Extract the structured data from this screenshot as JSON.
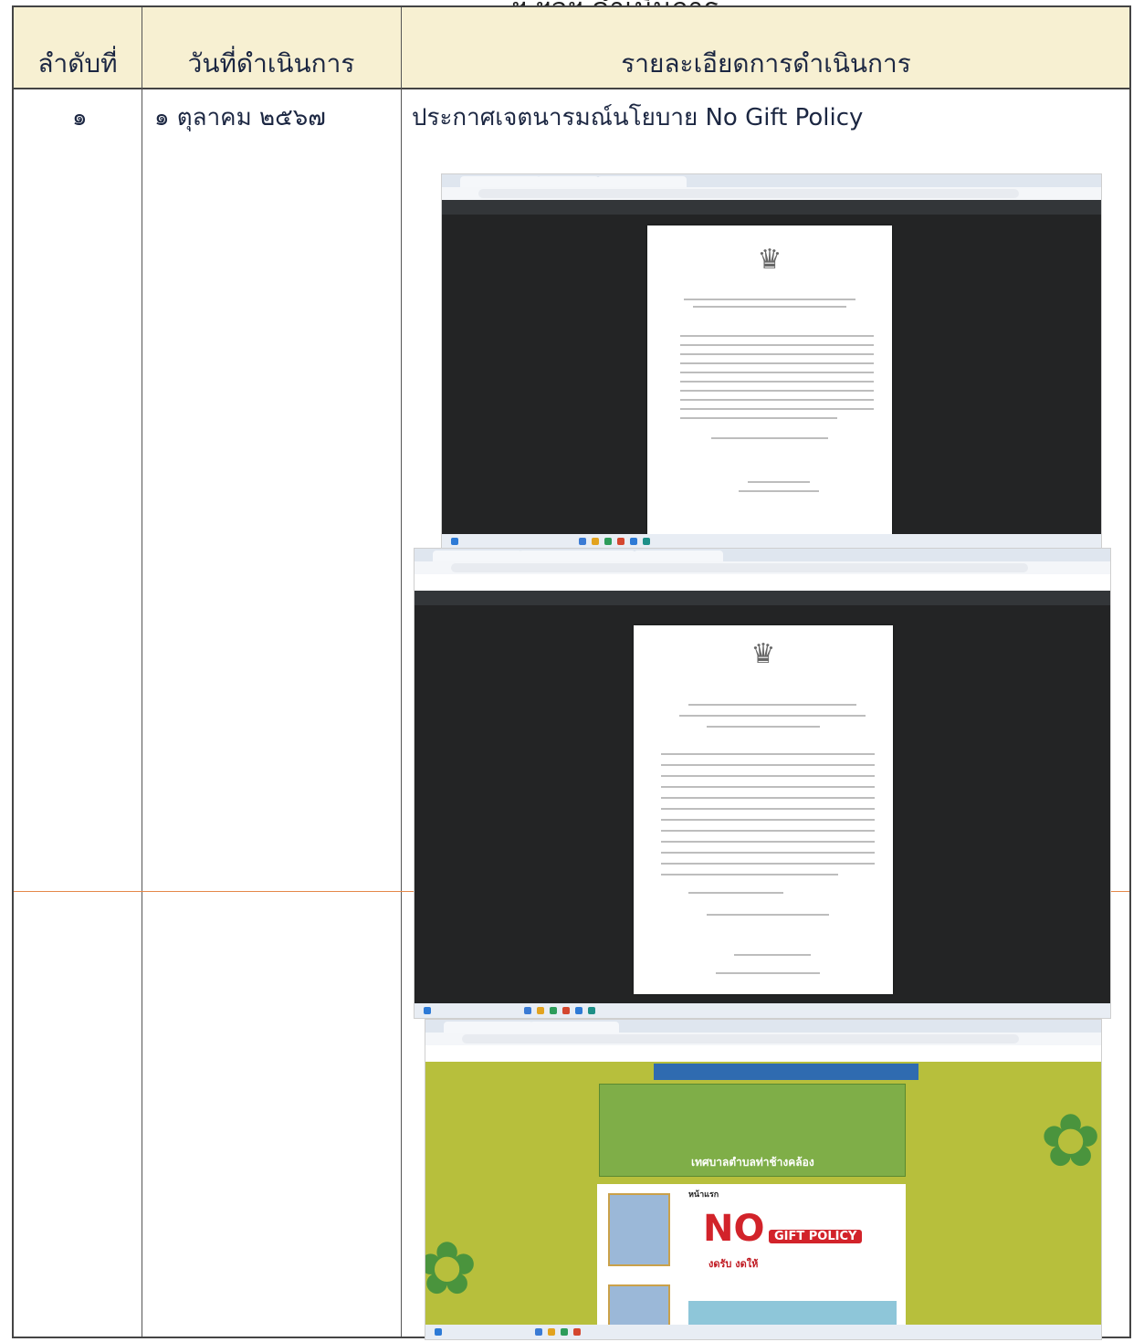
{
  "page_top_text": "ฯ ฯลฯ ดำเนินการ",
  "table": {
    "headers": [
      "ลำดับที่",
      "วันที่ดำเนินการ",
      "รายละเอียดการดำเนินการ"
    ],
    "rows": [
      {
        "order": "๑",
        "date": "๑ ตุลาคม ๒๕๖๗",
        "detail": "ประกาศเจตนารมณ์นโยบาย No Gift Policy"
      }
    ]
  },
  "screenshots": {
    "website": {
      "site_name": "เทศบาลตำบลท่าช้างคล้อง",
      "section_title": "หน้าแรก",
      "promo_no": "NO",
      "promo_gift": "GIFT POLICY",
      "promo_sub": "งดรับ งดให้"
    }
  },
  "colors": {
    "header_bg": "#f7f0d2",
    "pdf_dark": "#232425",
    "website_bg": "#b7bf3c",
    "promo_red": "#d2232a"
  }
}
